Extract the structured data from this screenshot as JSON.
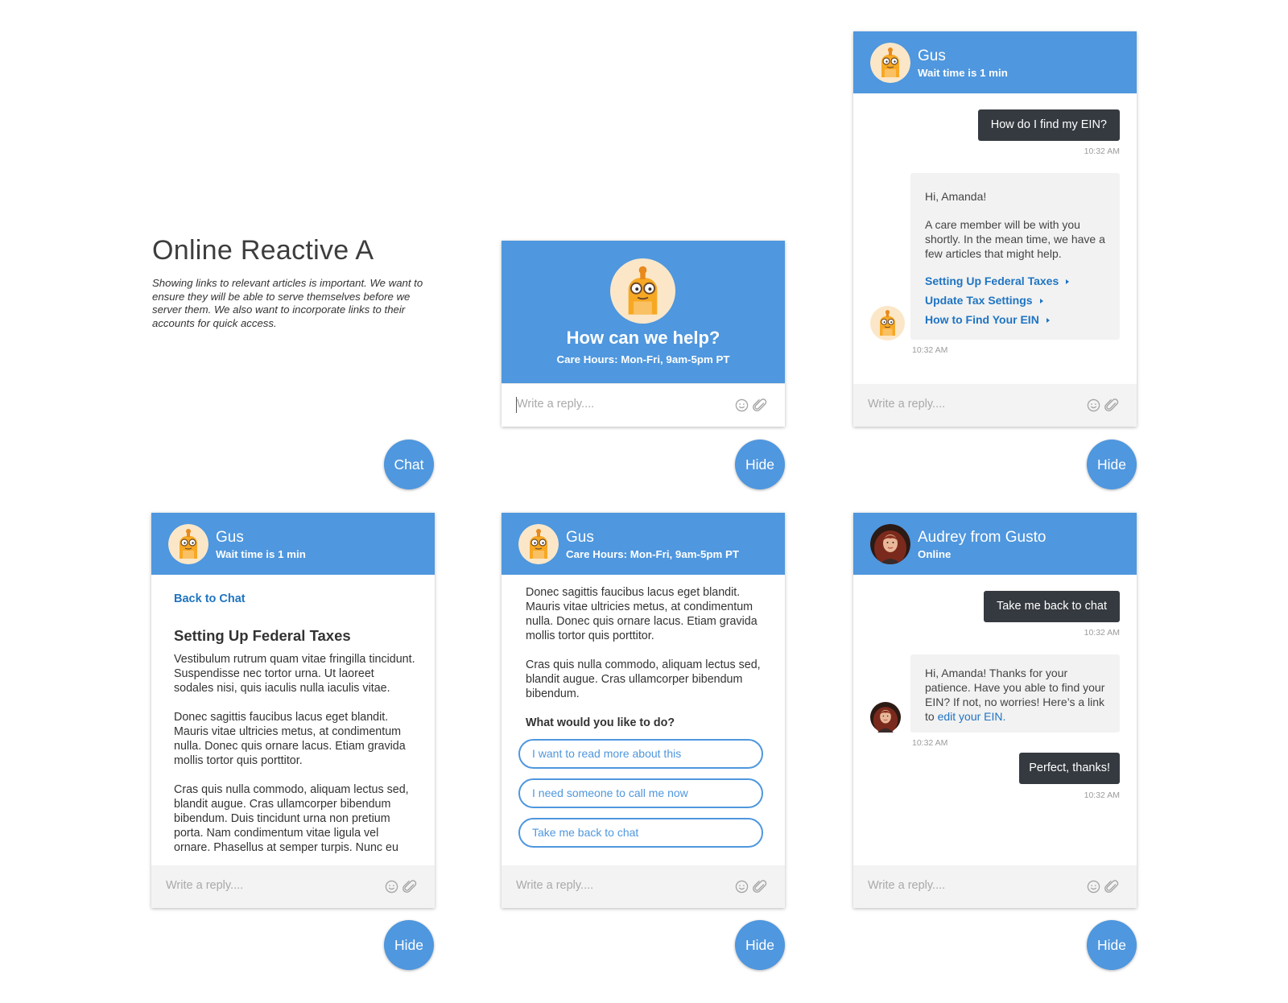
{
  "intro": {
    "title": "Online Reactive A",
    "description": "Showing links to relevant articles is important. We want to ensure they will be able to serve themselves before we server them. We also want to incorporate links to their accounts for quick access."
  },
  "buttons": {
    "chat": "Chat",
    "hide": "Hide"
  },
  "reply_placeholder": "Write a reply....",
  "icons": {
    "emoji": "smiley-icon",
    "attach": "paperclip-icon"
  },
  "colors": {
    "header_blue": "#4f97de",
    "dark_bubble": "#353a40",
    "link_blue": "#1f74c2"
  },
  "welcome": {
    "title": "How can we help?",
    "hours": "Care Hours: Mon-Fri, 9am-5pm PT"
  },
  "chat1": {
    "name": "Gus",
    "status": "Wait time is 1 min",
    "question": "How do I find my EIN?",
    "question_time": "10:32 AM",
    "greeting": "Hi, Amanda!",
    "message": "A care member will be with you shortly. In the mean time, we have a few articles that might help.",
    "articles": [
      "Setting Up Federal Taxes",
      "Update Tax Settings",
      "How to Find Your EIN"
    ],
    "reply_time": "10:32 AM"
  },
  "article": {
    "name": "Gus",
    "status": "Wait time is 1 min",
    "back": "Back to Chat",
    "title": "Setting Up Federal Taxes",
    "p1": "Vestibulum rutrum quam vitae fringilla tincidunt. Suspendisse nec tortor urna. Ut laoreet sodales nisi, quis iaculis nulla iaculis vitae.",
    "p2": "Donec sagittis faucibus lacus eget blandit. Mauris vitae ultricies metus, at condimentum nulla. Donec quis ornare lacus. Etiam gravida mollis tortor quis porttitor.",
    "p3": "Cras quis nulla commodo, aliquam lectus sed, blandit augue. Cras ullamcorper bibendum bibendum. Duis tincidunt urna non pretium porta. Nam condimentum vitae ligula vel ornare. Phasellus at semper turpis. Nunc eu"
  },
  "options": {
    "name": "Gus",
    "status": "Care Hours: Mon-Fri, 9am-5pm PT",
    "p1": "Donec sagittis faucibus lacus eget blandit. Mauris vitae ultricies metus, at condimentum nulla. Donec quis ornare lacus. Etiam gravida mollis tortor quis porttitor.",
    "p2": "Cras quis nulla commodo, aliquam lectus sed, blandit augue. Cras ullamcorper bibendum bibendum.",
    "question": "What would you like to do?",
    "choices": [
      "I want to read more about this",
      "I need someone to call me now",
      "Take me back to chat"
    ]
  },
  "agent": {
    "name": "Audrey from Gusto",
    "status": "Online",
    "msg1": "Take me back to chat",
    "msg1_time": "10:32 AM",
    "reply_text": "Hi, Amanda! Thanks for your patience. Have you able to find your EIN? If not, no worries! Here’s a link to",
    "reply_link": "edit your EIN.",
    "reply_time": "10:32 AM",
    "msg2": "Perfect, thanks!",
    "msg2_time": "10:32 AM"
  }
}
